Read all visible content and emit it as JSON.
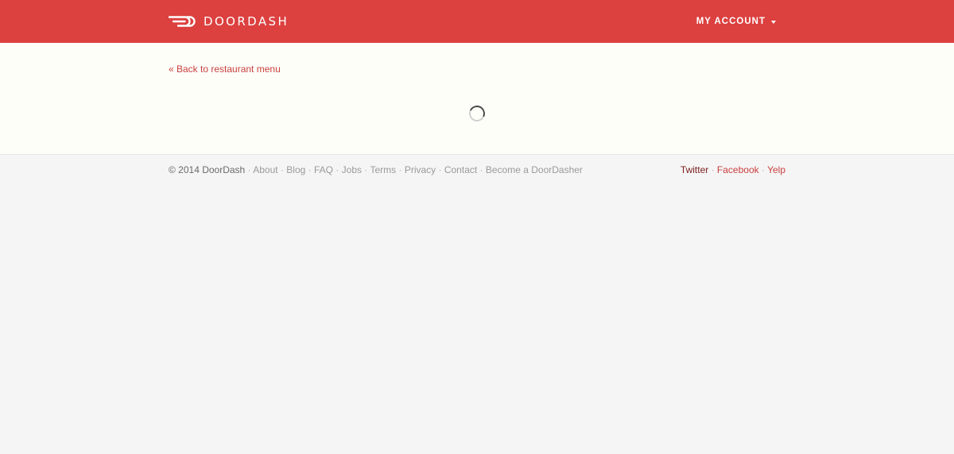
{
  "header": {
    "brand": "DOORDASH",
    "account_label": "MY ACCOUNT"
  },
  "main": {
    "back_link": "« Back to restaurant menu"
  },
  "footer": {
    "copyright": "© 2014 DoorDash",
    "separator": " · ",
    "links": [
      "About",
      "Blog",
      "FAQ",
      "Jobs",
      "Terms",
      "Privacy",
      "Contact",
      "Become a DoorDasher"
    ],
    "social": [
      "Twitter",
      "Facebook",
      "Yelp"
    ]
  },
  "colors": {
    "brand_red": "#dc403f",
    "link_red": "#c9403e",
    "page_bg": "#f5f5f5",
    "content_bg": "#fefef9"
  },
  "icons": {
    "logo": "doordash-logo-icon",
    "account_caret": "caret-down-icon",
    "loading": "loading-spinner-icon"
  }
}
